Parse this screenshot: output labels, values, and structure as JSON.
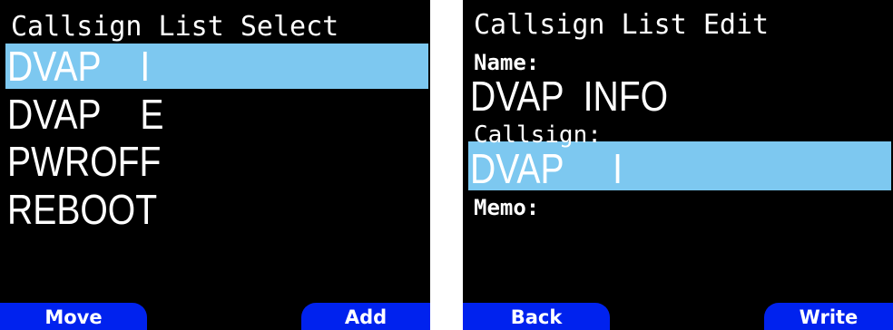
{
  "left_screen": {
    "title": "Callsign List Select",
    "items": [
      {
        "text": "DVAP    I"
      },
      {
        "text": "DVAP    E"
      },
      {
        "text": "PWROFF"
      },
      {
        "text": "REBOOT"
      }
    ],
    "softkey_left": "Move",
    "softkey_right": "Add",
    "highlight_color": "#7dc8f0"
  },
  "right_screen": {
    "title": "Callsign List Edit",
    "name_label": "Name:",
    "name_value": "DVAP  INFO",
    "callsign_label": "Callsign:",
    "callsign_value": "DVAP     I",
    "memo_label": "Memo:",
    "softkey_left": "Back",
    "softkey_right": "Write",
    "softkey_color": "#0022ee"
  }
}
